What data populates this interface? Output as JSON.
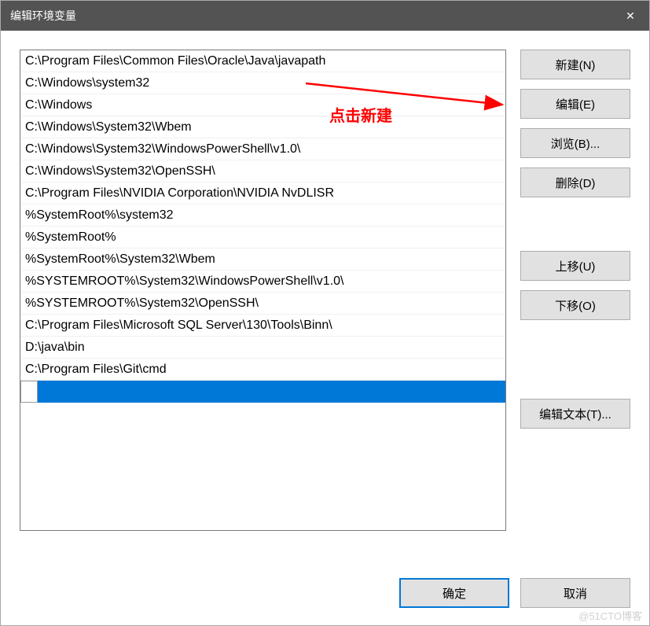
{
  "title": "编辑环境变量",
  "close_icon": "✕",
  "annotation": {
    "text": "点击新建"
  },
  "list": {
    "items": [
      "C:\\Program Files\\Common Files\\Oracle\\Java\\javapath",
      "C:\\Windows\\system32",
      "C:\\Windows",
      "C:\\Windows\\System32\\Wbem",
      "C:\\Windows\\System32\\WindowsPowerShell\\v1.0\\",
      "C:\\Windows\\System32\\OpenSSH\\",
      "C:\\Program Files\\NVIDIA Corporation\\NVIDIA NvDLISR",
      "%SystemRoot%\\system32",
      "%SystemRoot%",
      "%SystemRoot%\\System32\\Wbem",
      "%SYSTEMROOT%\\System32\\WindowsPowerShell\\v1.0\\",
      "%SYSTEMROOT%\\System32\\OpenSSH\\",
      "C:\\Program Files\\Microsoft SQL Server\\130\\Tools\\Binn\\",
      "D:\\java\\bin",
      "C:\\Program Files\\Git\\cmd"
    ],
    "editing_value": ""
  },
  "buttons": {
    "new": "新建(N)",
    "edit": "编辑(E)",
    "browse": "浏览(B)...",
    "delete": "删除(D)",
    "moveup": "上移(U)",
    "movedown": "下移(O)",
    "edittext": "编辑文本(T)...",
    "ok": "确定",
    "cancel": "取消"
  },
  "watermark": "@51CTO博客"
}
